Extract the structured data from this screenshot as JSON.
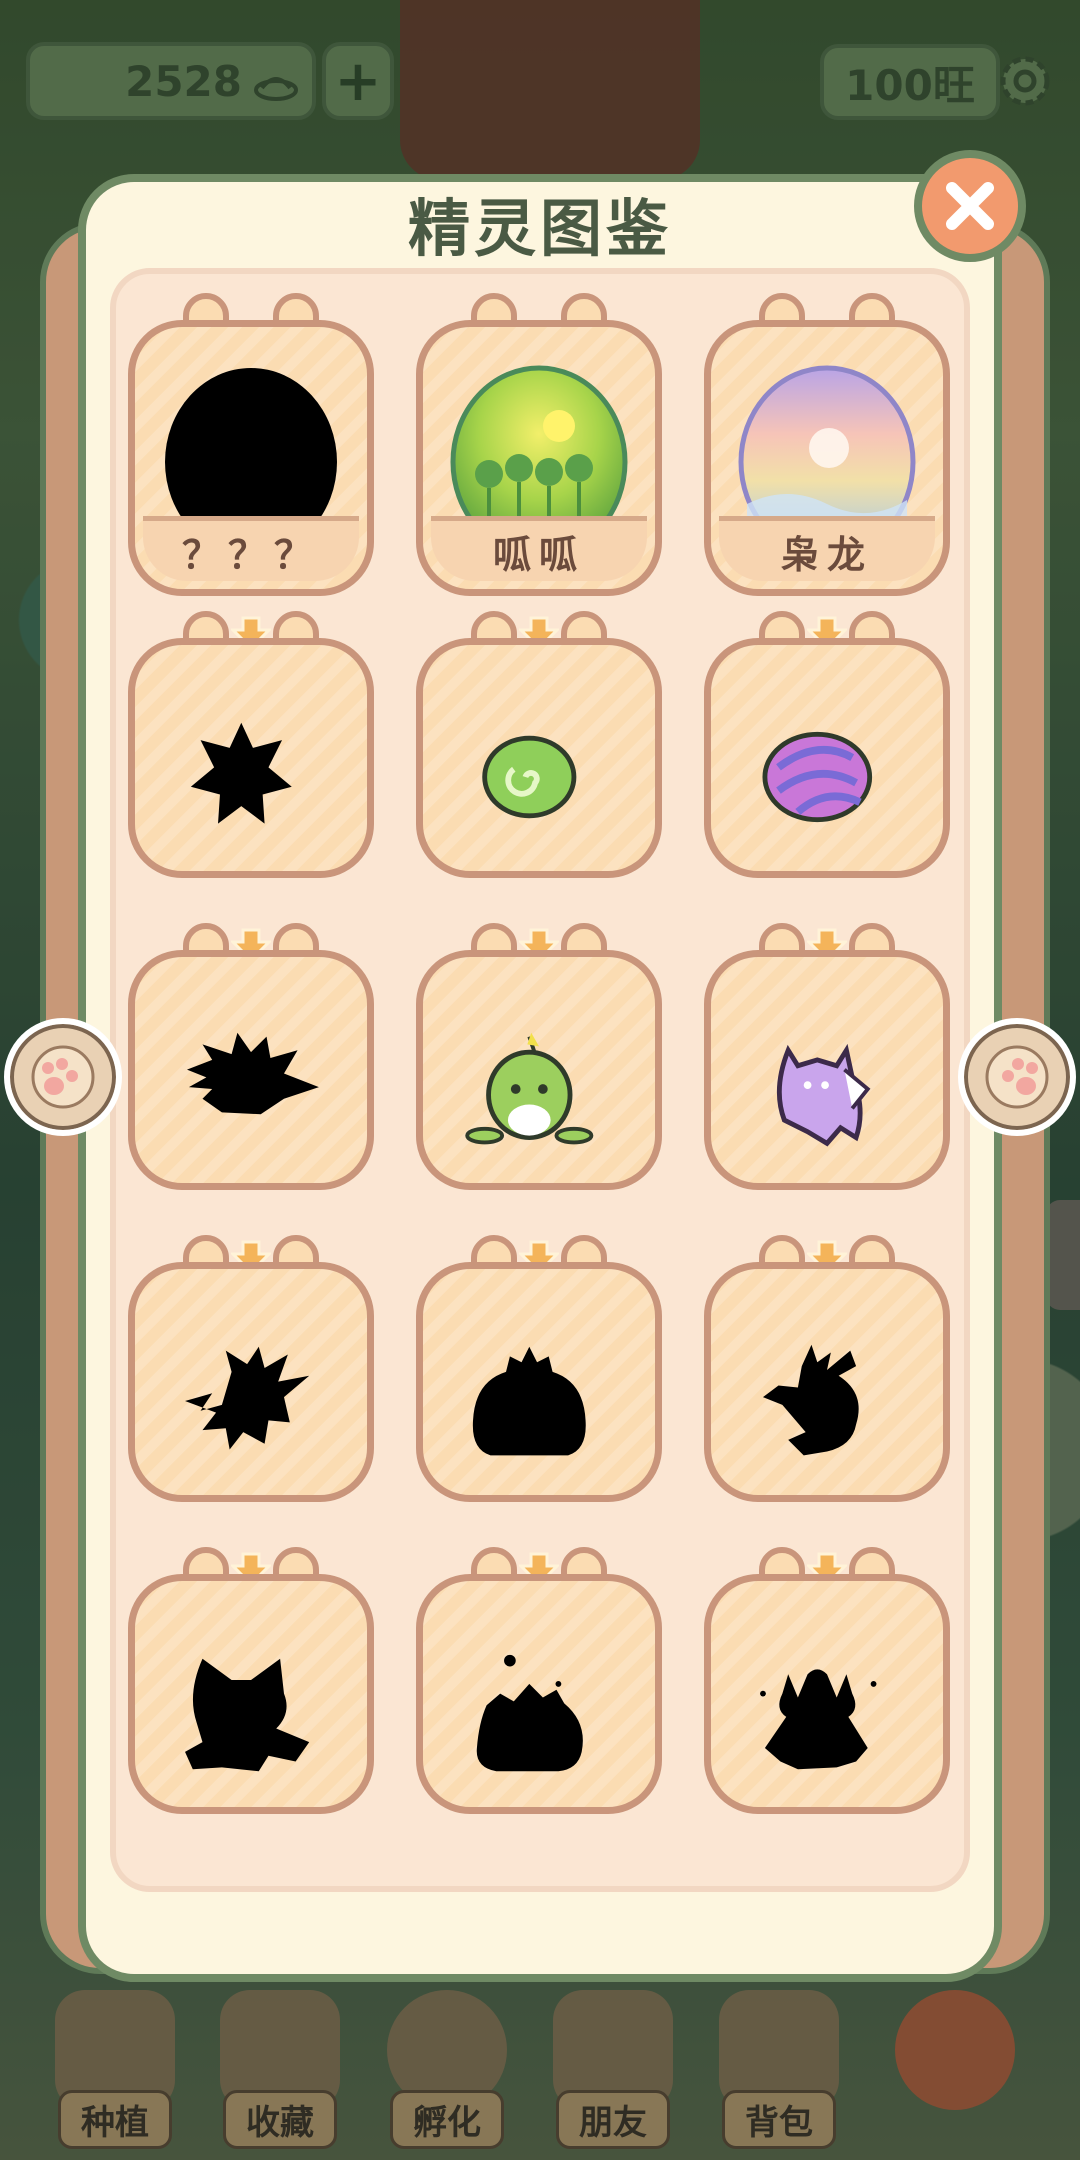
{
  "hud": {
    "coins": "2528",
    "plus_label": "+",
    "wang": "100旺"
  },
  "panel": {
    "title": "精灵图鉴"
  },
  "eggs": [
    {
      "name": "？？？",
      "icon": "unknown-egg-silhouette"
    },
    {
      "name": "呱呱",
      "icon": "green-forest-egg"
    },
    {
      "name": "枭龙",
      "icon": "rainbow-egg"
    }
  ],
  "evolutions": [
    [
      "spiky-seed-silhouette",
      "green-spiral-seed",
      "purple-striped-seed"
    ],
    [
      "spiky-creature-silhouette",
      "green-sprout-frog",
      "purple-ghost-cat"
    ],
    [
      "lightning-beast-silhouette",
      "big-frog-silhouette",
      "antlered-ghost-silhouette"
    ],
    [
      "winged-cat-silhouette",
      "sparkling-mound-silhouette",
      "horned-king-silhouette"
    ]
  ],
  "bottom_nav": [
    {
      "label": "种植"
    },
    {
      "label": "收藏"
    },
    {
      "label": "孵化"
    },
    {
      "label": "朋友"
    },
    {
      "label": "背包"
    }
  ],
  "colors": {
    "panel_border": "#6f8a64",
    "card_border": "#c9957b",
    "card_fill": "#fbdcb2",
    "close_button": "#f29a6e",
    "title_text": "#4a5a44"
  }
}
